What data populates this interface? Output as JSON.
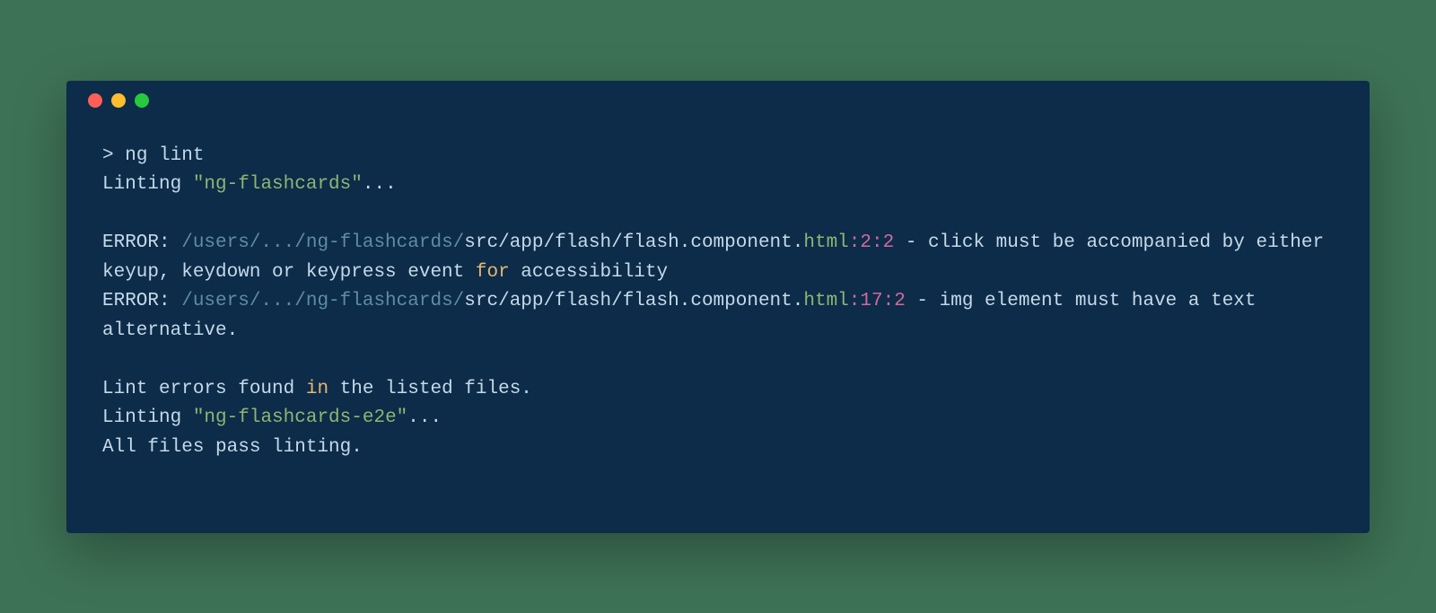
{
  "terminal": {
    "prompt": "> ",
    "command": "ng lint",
    "line2_prefix": "Linting ",
    "line2_quoted": "\"ng-flashcards\"",
    "line2_suffix": "...",
    "error1": {
      "label": "ERROR: ",
      "path_dim": "/users/.../ng-flashcards/",
      "path_light": "src/app/flash/flash",
      "dot1": ".",
      "component": "component",
      "dot2": ".",
      "ext": "html",
      "colon": ":",
      "loc": "2:2",
      "dash": " - ",
      "msg_a": "click must be accompanied by either keyup, keydown or keypress event ",
      "kw_for": "for",
      "msg_b": " accessibility"
    },
    "error2": {
      "label": "ERROR: ",
      "path_dim": "/users/.../ng-flashcards/",
      "path_light": "src/app/flash/flash",
      "dot1": ".",
      "component": "component",
      "dot2": ".",
      "ext": "html",
      "colon": ":",
      "loc": "17:2",
      "dash": " - ",
      "msg": "img element must have a text alternative."
    },
    "summary1_a": "Lint errors found ",
    "summary1_kw": "in",
    "summary1_b": " the listed files.",
    "line_e2e_prefix": "Linting ",
    "line_e2e_quoted": "\"ng-flashcards-e2e\"",
    "line_e2e_suffix": "...",
    "pass_line": "All files pass linting."
  }
}
